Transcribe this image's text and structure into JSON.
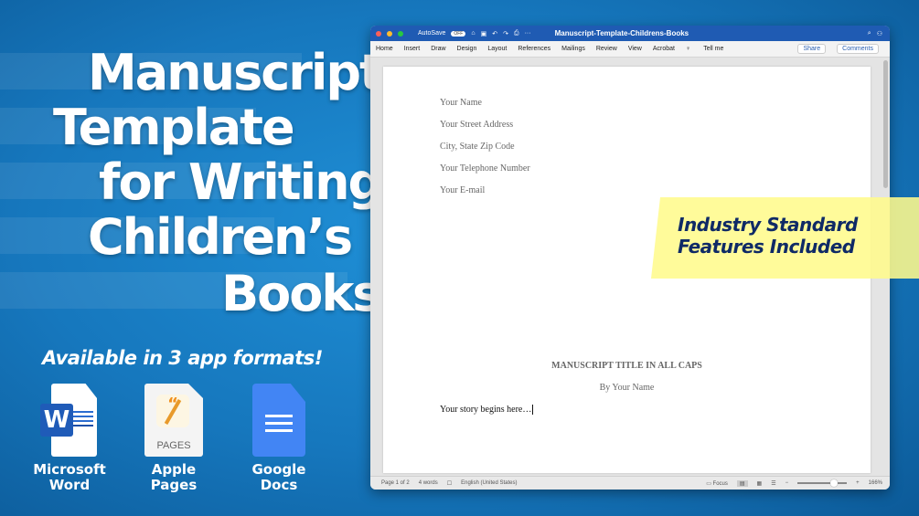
{
  "headline": {
    "lines": [
      "Manuscript",
      "Template",
      "for Writing",
      "Children’s",
      "Books"
    ]
  },
  "available": "Available in 3 app formats!",
  "apps": [
    {
      "name": "Microsoft Word",
      "line1": "Microsoft",
      "line2": "Word",
      "icon": "word-icon"
    },
    {
      "name": "Apple Pages",
      "line1": "Apple",
      "line2": "Pages",
      "icon": "pages-icon",
      "icon_text": "PAGES"
    },
    {
      "name": "Google Docs",
      "line1": "Google",
      "line2": "Docs",
      "icon": "google-docs-icon"
    }
  ],
  "window": {
    "autosave": "AutoSave",
    "autosave_state": "OFF",
    "doc_title": "Manuscript-Template-Childrens-Books",
    "tabs": [
      "Home",
      "Insert",
      "Draw",
      "Design",
      "Layout",
      "References",
      "Mailings",
      "Review",
      "View",
      "Acrobat",
      "Tell me"
    ],
    "share": "Share",
    "comments": "Comments"
  },
  "document": {
    "address": [
      "Your Name",
      "Your Street Address",
      "City, State Zip Code",
      "Your Telephone Number",
      "Your E-mail"
    ],
    "title": "MANUSCRIPT TITLE IN ALL CAPS",
    "byline": "By Your Name",
    "body": "Your story begins here…"
  },
  "status": {
    "page": "Page 1 of 2",
    "words": "4 words",
    "language": "English (United States)",
    "focus": "Focus",
    "zoom": "166%",
    "zoom_level": 166
  },
  "banner": {
    "line1": "Industry Standard",
    "line2": "Features Included"
  },
  "colors": {
    "titlebar": "#1f5bb3",
    "banner": "#fff98c",
    "banner_text": "#0f2a66"
  }
}
